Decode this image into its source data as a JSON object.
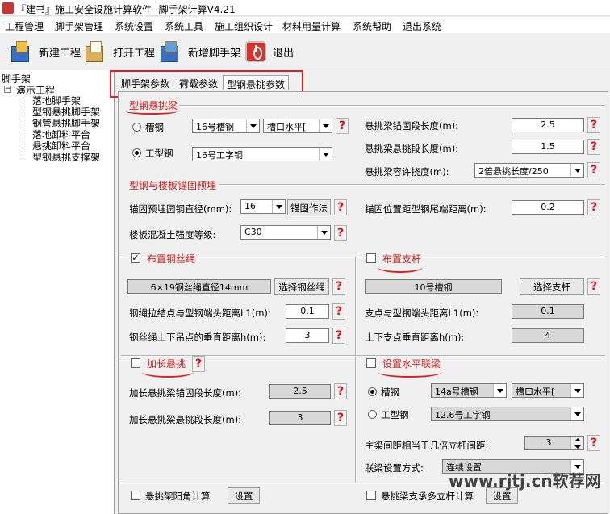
{
  "window": {
    "title": "『建书』施工安全设施计算软件--脚手架计算V4.21"
  },
  "menu": [
    "工程管理",
    "脚手架管理",
    "系统设置",
    "系统工具",
    "施工组织设计",
    "材料用量计算",
    "系统帮助",
    "退出系统"
  ],
  "toolbar": {
    "new_project": "新建工程",
    "open_project": "打开工程",
    "add_scaffold": "新增脚手架",
    "exit": "退出"
  },
  "tree": {
    "root": "脚手架",
    "project": "演示工程",
    "items": [
      "落地脚手架",
      "型钢悬挑脚手架",
      "钢管悬挑脚手架",
      "落地卸料平台",
      "悬挑卸料平台",
      "型钢悬挑支撑架"
    ]
  },
  "tabs": [
    "脚手架参数",
    "荷载参数",
    "型钢悬挑参数"
  ],
  "help_symbol": "?",
  "sec_beam": {
    "title": "型钢悬挑梁",
    "opt_channel": "槽钢",
    "opt_ibeam": "工型钢",
    "channel_value": "16号槽钢",
    "channel_orient": "槽口水平[",
    "ibeam_value": "16号工字钢",
    "anchor_len_label": "悬挑梁锚固段长度(m):",
    "anchor_len": "2.5",
    "cant_len_label": "悬挑梁悬挑段长度(m):",
    "cant_len": "1.5",
    "deflect_label": "悬挑梁容许挠度(m):",
    "deflect": "2倍悬挑长度/250"
  },
  "sec_anchor": {
    "title": "型钢与楼板锚固预埋",
    "bar_dia_label": "锚固预埋圆钢直径(mm):",
    "bar_dia": "16",
    "method_btn": "锚固作法",
    "pos_label": "锚固位置距型钢尾端距离(m):",
    "pos": "0.2",
    "concrete_label": "楼板混凝土强度等级:",
    "concrete": "C30"
  },
  "sec_rope": {
    "title": "布置钢丝绳",
    "checked": true,
    "rope_value": "6×19钢丝绳直径14mm",
    "select_btn": "选择钢丝绳",
    "l1_label": "钢绳拉结点与型钢端头距离L1(m):",
    "l1": "0.1",
    "h_label": "钢丝绳上下吊点的垂直距离h(m):",
    "h": "3"
  },
  "sec_strut": {
    "title": "布置支杆",
    "checked": false,
    "strut_value": "10号槽钢",
    "select_btn": "选择支杆",
    "l1_label": "支点与型钢端头距离L1(m):",
    "l1": "0.1",
    "h_label": "上下支点垂直距离h(m):",
    "h": "4"
  },
  "sec_extend": {
    "title": "加长悬挑",
    "checked": false,
    "anchor_label": "加长悬挑梁锚固段长度(m):",
    "anchor": "2.5",
    "cant_label": "加长悬挑梁悬挑段长度(m):",
    "cant": "3"
  },
  "sec_link": {
    "title": "设置水平联梁",
    "checked": false,
    "opt_channel": "槽钢",
    "opt_ibeam": "工型钢",
    "channel_value": "14a号槽钢",
    "channel_orient": "槽口水平[",
    "ibeam_value": "12.6号工字钢",
    "spacing_label": "主梁间距相当于几倍立杆间距:",
    "spacing": "3",
    "method_label": "联梁设置方式:",
    "method": "连续设置"
  },
  "bottom": {
    "corner_calc": "悬挑架阳角计算",
    "corner_btn": "设置",
    "multi_pole": "悬挑梁支承多立杆计算",
    "multi_btn": "设置"
  },
  "watermark": "www.rjtj.cn软荐网",
  "colors": {
    "accent_red": "#e02020"
  }
}
